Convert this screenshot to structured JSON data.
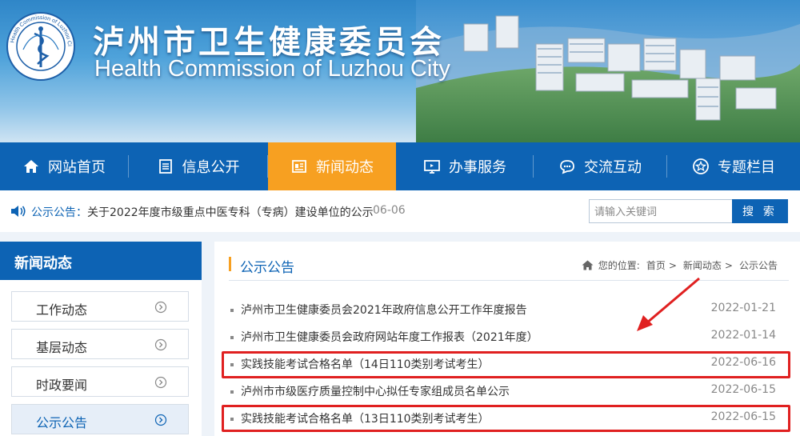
{
  "header": {
    "title": "泸州市卫生健康委员会",
    "subtitle": "Health Commission of Luzhou City",
    "logo_icon": "health-commission-emblem",
    "logo_ring_text": "Health Commission of Luzhou City"
  },
  "nav": {
    "items": [
      {
        "label": "网站首页",
        "icon": "home-icon",
        "active": false
      },
      {
        "label": "信息公开",
        "icon": "document-icon",
        "active": false
      },
      {
        "label": "新闻动态",
        "icon": "newspaper-icon",
        "active": true
      },
      {
        "label": "办事服务",
        "icon": "monitor-icon",
        "active": false
      },
      {
        "label": "交流互动",
        "icon": "chat-icon",
        "active": false
      },
      {
        "label": "专题栏目",
        "icon": "star-icon",
        "active": false
      }
    ]
  },
  "notice": {
    "label": "公示公告：",
    "text": "关于2022年度市级重点中医专科（专病）建设单位的公示",
    "date": "06-06"
  },
  "search": {
    "placeholder": "请输入关键词",
    "button": "搜 索"
  },
  "sidebar": {
    "title": "新闻动态",
    "items": [
      {
        "label": "工作动态",
        "active": false
      },
      {
        "label": "基层动态",
        "active": false
      },
      {
        "label": "时政要闻",
        "active": false
      },
      {
        "label": "公示公告",
        "active": true
      }
    ]
  },
  "content": {
    "title": "公示公告",
    "breadcrumb": {
      "prefix": "您的位置:",
      "items": [
        "首页",
        "新闻动态",
        "公示公告"
      ],
      "separator": ">"
    },
    "rows": [
      {
        "title": "泸州市卫生健康委员会2021年政府信息公开工作年度报告",
        "date": "2022-01-21",
        "highlighted": false
      },
      {
        "title": "泸州市卫生健康委员会政府网站年度工作报表（2021年度）",
        "date": "2022-01-14",
        "highlighted": false
      },
      {
        "title": "实践技能考试合格名单（14日110类别考试考生）",
        "date": "2022-06-16",
        "highlighted": true
      },
      {
        "title": "泸州市市级医疗质量控制中心拟任专家组成员名单公示",
        "date": "2022-06-15",
        "highlighted": false
      },
      {
        "title": "实践技能考试合格名单（13日110类别考试考生）",
        "date": "2022-06-15",
        "highlighted": true
      }
    ]
  },
  "colors": {
    "primary": "#0d63b4",
    "active_tab": "#f7a021",
    "highlight": "#e02020"
  }
}
